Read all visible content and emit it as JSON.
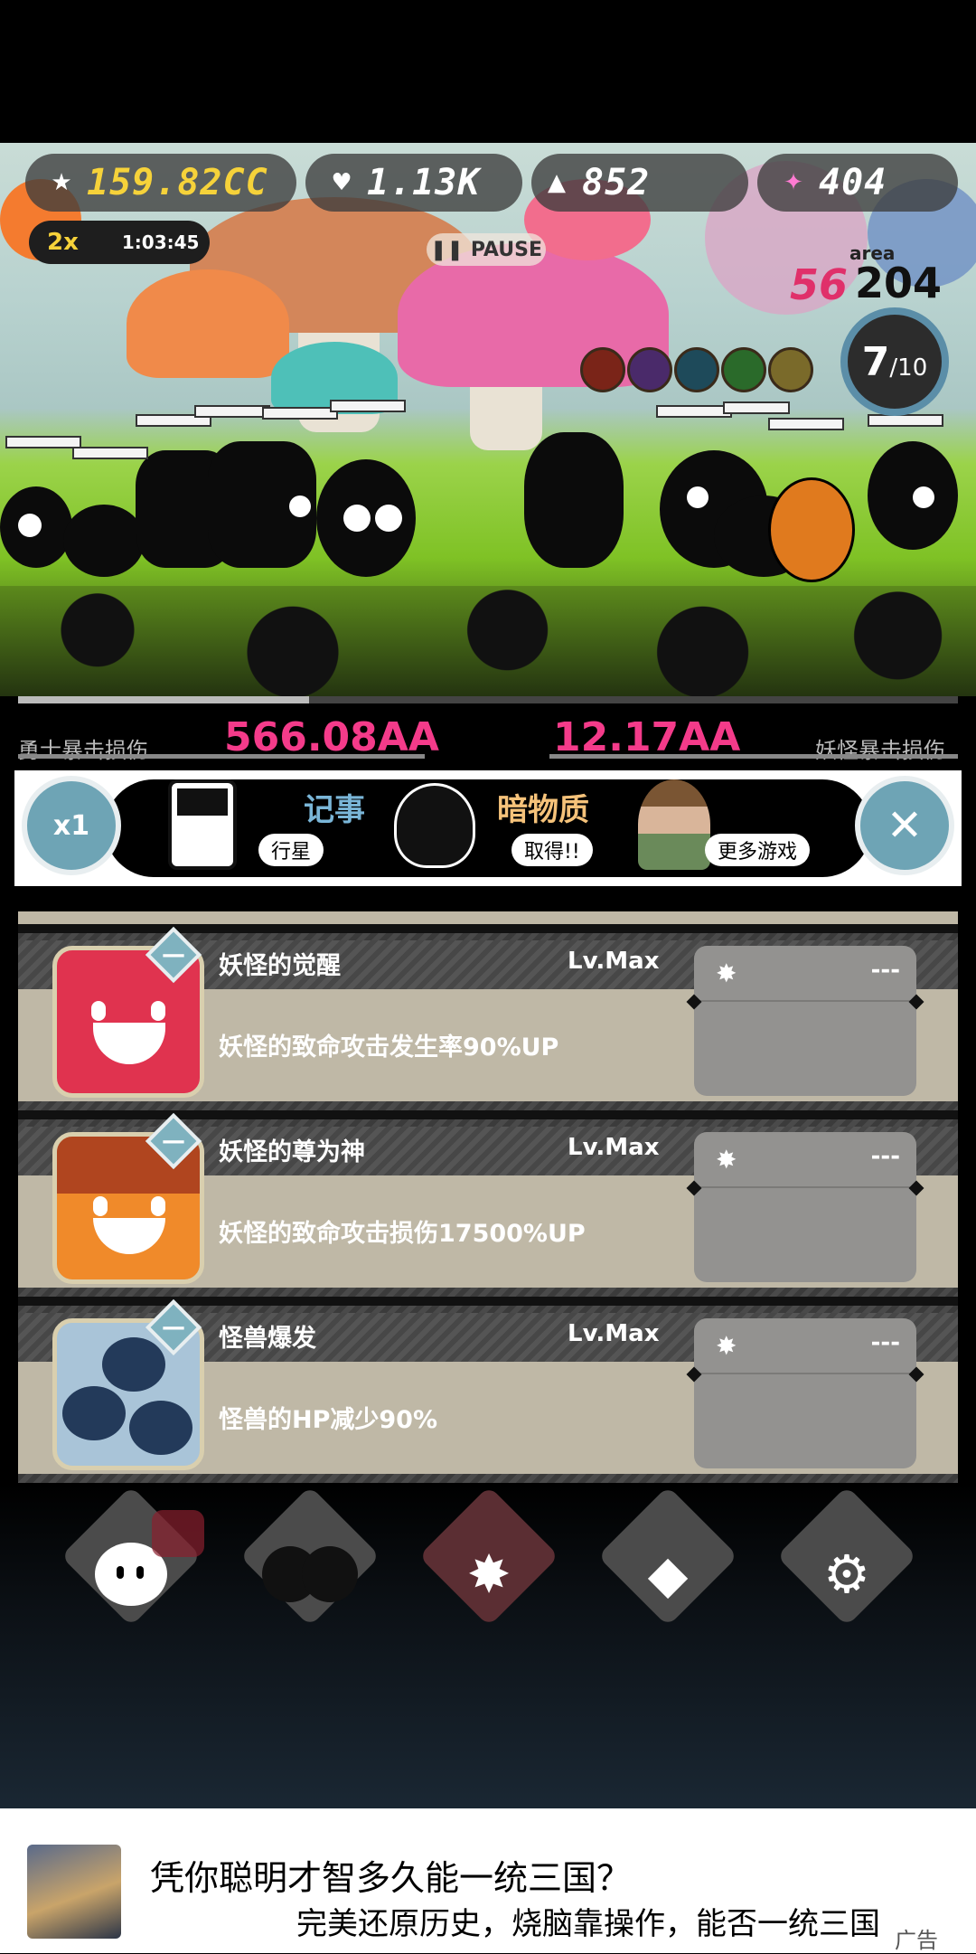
{
  "hud": {
    "gold": "159.82CC",
    "hearts": "1.13K",
    "triangle": "852",
    "gems": "404",
    "speed": "2x",
    "timer": "1:03:45",
    "pause": "PAUSE",
    "area_label": "area",
    "area_value": "204",
    "area_prev": "56",
    "wave_current": "7",
    "wave_total": "/10"
  },
  "damage": {
    "hero_label": "勇士暴击损伤",
    "hero_value": "566.08AA",
    "monster_value": "12.17AA",
    "monster_label": "妖怪暴击损伤"
  },
  "menu": {
    "speed_button": "x1",
    "items": [
      {
        "title": "记事",
        "sub": "行星"
      },
      {
        "title": "暗物质",
        "sub": "取得!!"
      },
      {
        "title": "",
        "sub": "更多游戏"
      }
    ],
    "close": "✕"
  },
  "upgrades": [
    {
      "title": "妖怪的觉醒",
      "level": "Lv.Max",
      "desc": "妖怪的致命攻击发生率90%UP",
      "cost": "---",
      "icon": "angry-red-face-icon"
    },
    {
      "title": "妖怪的尊为神",
      "level": "Lv.Max",
      "desc": "妖怪的致命攻击损伤17500%UP",
      "cost": "---",
      "icon": "orange-flame-face-icon"
    },
    {
      "title": "怪兽爆发",
      "level": "Lv.Max",
      "desc": "怪兽的HP减少90%",
      "cost": "---",
      "icon": "dead-cats-icon"
    }
  ],
  "nav": [
    {
      "name": "hero-icon",
      "glyph": ""
    },
    {
      "name": "monsters-icon",
      "glyph": ""
    },
    {
      "name": "star-icon",
      "glyph": "✸"
    },
    {
      "name": "gem-icon",
      "glyph": "◆"
    },
    {
      "name": "settings-gear-icon",
      "glyph": "⚙"
    }
  ],
  "ad": {
    "line1": "凭你聪明才智多久能一统三国？",
    "line2": "完美还原历史，烧脑靠操作，能否一统三国",
    "label": "广告"
  },
  "colors": {
    "gold": "#f6d23a",
    "damage": "#f43b8a",
    "accent_blue": "#6ea4b5",
    "nav_active": "#5b2e33"
  },
  "progress": 0.31
}
